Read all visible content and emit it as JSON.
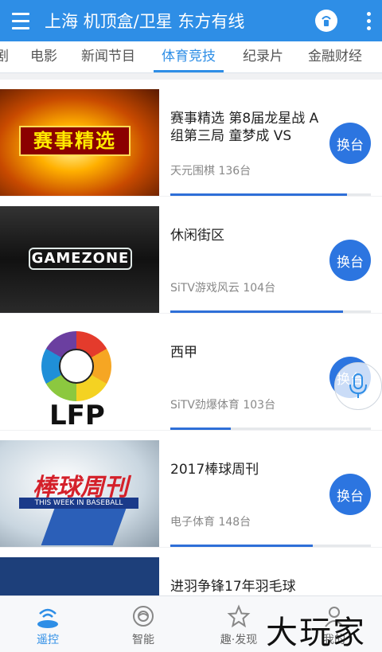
{
  "header": {
    "title": "上海 机顶盒/卫星 东方有线"
  },
  "tabs": [
    {
      "label": "剧"
    },
    {
      "label": "电影"
    },
    {
      "label": "新闻节目"
    },
    {
      "label": "体育竞技"
    },
    {
      "label": "纪录片"
    },
    {
      "label": "金融财经"
    }
  ],
  "active_tab": "体育竞技",
  "programs": [
    {
      "title": "赛事精选 第8届龙星战 A组第三局 童梦成 VS",
      "channel": "天元围棋 136台",
      "progress": 0.88,
      "button": "换台",
      "thumb_text": "赛事精选"
    },
    {
      "title": "休闲街区",
      "channel": "SiTV游戏风云 104台",
      "progress": 0.86,
      "button": "换台",
      "thumb_text": "GAMEZONE"
    },
    {
      "title": "西甲",
      "channel": "SiTV劲爆体育 103台",
      "progress": 0.3,
      "button": "换台",
      "thumb_text": "LFP"
    },
    {
      "title": "2017棒球周刊",
      "channel": "电子体育 148台",
      "progress": 0.71,
      "button": "换台",
      "thumb_text": "棒球周刊"
    },
    {
      "title": "进羽争锋17年羽毛球",
      "channel": "",
      "progress": 0,
      "button": ""
    }
  ],
  "bottom_nav": [
    {
      "label": "遥控",
      "icon": "remote-icon"
    },
    {
      "label": "智能",
      "icon": "smart-icon"
    },
    {
      "label": "趣·发现",
      "icon": "star-icon"
    },
    {
      "label": "我的",
      "icon": "person-icon"
    }
  ],
  "watermark": "大玩家",
  "colors": {
    "primary": "#2e8ee6",
    "button": "#2c75e0"
  }
}
